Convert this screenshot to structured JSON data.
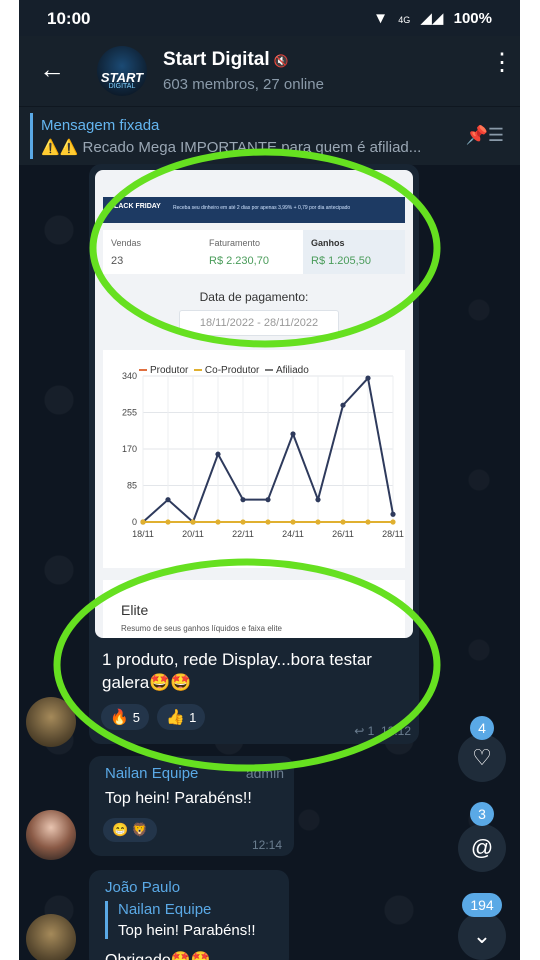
{
  "status_bar": {
    "time": "10:00",
    "left_icons": "31 31 ● ● •",
    "network": "4G",
    "battery": "100%"
  },
  "header": {
    "back_icon": "arrow-left",
    "title": "Start Digital",
    "members": "603 membros, 27 online",
    "avatar_text": "START",
    "avatar_sub": "DIGITAL"
  },
  "pinned": {
    "title": "Mensagem fixada",
    "text": "⚠️⚠️ Recado Mega IMPORTANTE para quem é afiliad..."
  },
  "screenshot": {
    "banner": "BLACK FRIDAY",
    "banner_text": "Receba seu dinheiro em até 2 dias por apenas 3,99% + 0,79 por dia antecipado",
    "cards": [
      {
        "label": "Vendas",
        "value": "23"
      },
      {
        "label": "Faturamento",
        "value": "R$ 2.230,70"
      },
      {
        "label": "Ganhos",
        "value": "R$ 1.205,50"
      }
    ],
    "date_label": "Data de pagamento:",
    "date_from": "18/11/2022",
    "date_to": "28/11/2022",
    "legend": [
      "Produtor",
      "Co-Produtor",
      "Afiliado"
    ],
    "elite_title": "Elite",
    "elite_sub": "Resumo de seus ganhos líquidos e faixa elite"
  },
  "chart_data": {
    "type": "line",
    "x": [
      "18/11",
      "19/11",
      "20/11",
      "21/11",
      "22/11",
      "23/11",
      "24/11",
      "25/11",
      "26/11",
      "27/11",
      "28/11"
    ],
    "x_ticks": [
      "18/11",
      "20/11",
      "22/11",
      "24/11",
      "26/11",
      "28/11"
    ],
    "y_ticks": [
      "0",
      "85",
      "170",
      "255",
      "340"
    ],
    "ylim": [
      0,
      340
    ],
    "series": [
      {
        "name": "Produtor",
        "color": "#2e3a5c",
        "values": [
          0,
          52,
          0,
          158,
          52,
          52,
          205,
          52,
          272,
          335,
          18,
          0
        ]
      },
      {
        "name": "Afiliado",
        "color": "#e0b030",
        "values": [
          0,
          0,
          0,
          0,
          0,
          0,
          0,
          0,
          0,
          0,
          0,
          0
        ]
      }
    ]
  },
  "message": {
    "text": "1 produto, rede Display...bora testar galera🤩🤩",
    "reactions": [
      {
        "emoji": "🔥",
        "count": "5"
      },
      {
        "emoji": "👍",
        "count": "1"
      }
    ],
    "replies": "1",
    "time": "12:12"
  },
  "msg2": {
    "sender": "Nailan Equipe",
    "role": "admin",
    "text": "Top hein! Parabéns!!",
    "reactions": [
      "😁",
      "🦁"
    ],
    "time": "12:14"
  },
  "msg3": {
    "sender": "João Paulo",
    "quote_name": "Nailan Equipe",
    "quote_text": "Top hein! Parabéns!!",
    "text": "Obrigado🤩🤩"
  },
  "fabs": {
    "reactions_count": "4",
    "mentions_count": "3",
    "unread_count": "194"
  }
}
